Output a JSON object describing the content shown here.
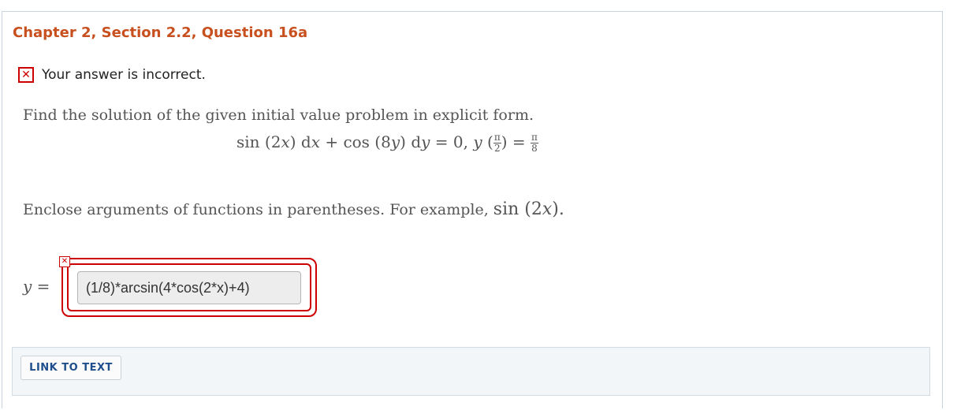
{
  "question": {
    "title": "Chapter 2, Section 2.2, Question 16a"
  },
  "feedback": {
    "icon": "x-mark-icon",
    "text": "Your answer is incorrect.",
    "color": "#cc0000"
  },
  "problem": {
    "prompt": "Find the solution of the given initial value problem in explicit form.",
    "equation": {
      "part1": "sin (2",
      "var_x": "x",
      "part2": ") d",
      "part3": " + cos (8",
      "var_y": "y",
      "part4": ") d",
      "part5": " = 0,  ",
      "part6": " (",
      "part7": ") = ",
      "pi": "π",
      "two": "2",
      "eight": "8"
    },
    "hint_prefix": "Enclose arguments of functions in parentheses. For example, ",
    "hint_math": "sin (2",
    "hint_math_var": "x",
    "hint_suffix": ")."
  },
  "answer": {
    "label_var": "y",
    "label_eq": " =",
    "value": "(1/8)*arcsin(4*cos(2*x)+4)",
    "status_icon": "x-mark-icon"
  },
  "toolbar": {
    "link_label": "LINK TO TEXT"
  },
  "colors": {
    "title": "#c8501f",
    "error": "#cc0000",
    "link": "#1f4e8c"
  }
}
